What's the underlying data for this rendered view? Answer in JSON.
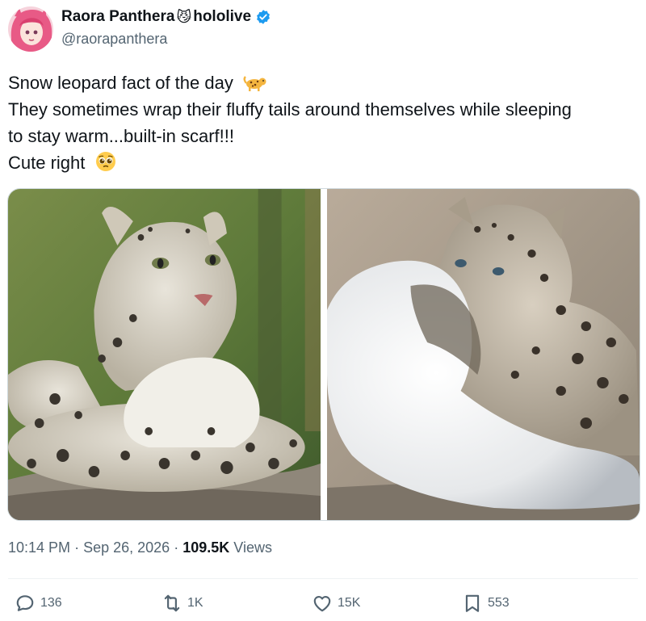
{
  "author": {
    "display_name": "Raora Panthera",
    "name_emoji": "😼",
    "affiliation": "hololive",
    "handle": "@raorapanthera"
  },
  "tweet": {
    "lines": [
      "Snow leopard fact of the day",
      "They sometimes wrap their fluffy tails around themselves while sleeping",
      "to stay warm...built-in scarf!!!",
      "Cute right"
    ],
    "line1_emoji": "leopard-emoji",
    "line4_emoji": "pleading-face-emoji"
  },
  "media": [
    {
      "icon": "photo-snow-leopard-resting"
    },
    {
      "icon": "photo-snow-leopard-cub-tail"
    }
  ],
  "meta": {
    "time": "10:14 PM",
    "separator": "·",
    "date": "Sep 26, 2026",
    "views_count": "109.5K",
    "views_label": "Views"
  },
  "actions": {
    "replies": "136",
    "reposts": "1K",
    "likes": "15K",
    "bookmarks": "553"
  },
  "colors": {
    "text": "#0f1419",
    "secondary": "#536471",
    "verified": "#1d9bf0"
  }
}
